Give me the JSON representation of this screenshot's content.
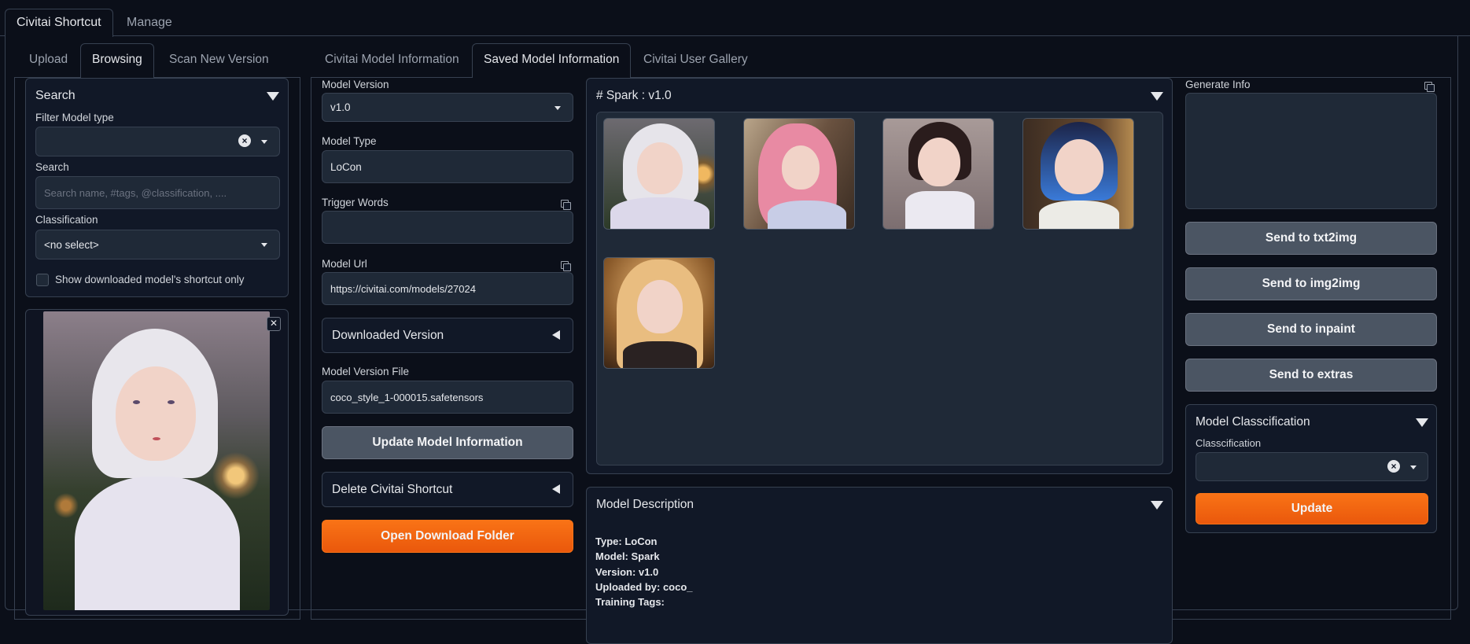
{
  "top_tabs": [
    "Civitai Shortcut",
    "Manage"
  ],
  "left_tabs": [
    "Upload",
    "Browsing",
    "Scan New Version"
  ],
  "info_tabs": [
    "Civitai Model Information",
    "Saved Model Information",
    "Civitai User Gallery"
  ],
  "search_panel": {
    "title": "Search",
    "filter_label": "Filter Model type",
    "filter_value": "",
    "search_label": "Search",
    "search_placeholder": "Search name, #tags, @classification, ....",
    "classification_label": "Classification",
    "classification_value": "<no select>",
    "checkbox_label": "Show downloaded model's shortcut only"
  },
  "model_info": {
    "version_label": "Model Version",
    "version_value": "v1.0",
    "type_label": "Model Type",
    "type_value": "LoCon",
    "trigger_label": "Trigger Words",
    "trigger_value": "",
    "url_label": "Model Url",
    "url_value": "https://civitai.com/models/27024",
    "downloaded_version": "Downloaded Version",
    "file_label": "Model Version File",
    "file_value": "coco_style_1-000015.safetensors",
    "update_button": "Update Model Information",
    "delete_accordion": "Delete Civitai Shortcut",
    "open_folder_button": "Open Download Folder"
  },
  "gallery": {
    "title": "# Spark : v1.0",
    "image_count": 5
  },
  "description": {
    "title": "Model Description",
    "lines": [
      "Type: LoCon",
      "Model: Spark",
      "Version: v1.0",
      "Uploaded by: coco_",
      "Training Tags:"
    ]
  },
  "generate": {
    "label": "Generate Info",
    "value": "",
    "send_txt2img": "Send to txt2img",
    "send_img2img": "Send to img2img",
    "send_inpaint": "Send to inpaint",
    "send_extras": "Send to extras"
  },
  "classification_panel": {
    "title": "Model Classcification",
    "label": "Classcification",
    "value": "",
    "update_button": "Update"
  },
  "colors": {
    "background": "#0b0f19",
    "panel": "#111827",
    "input": "#1f2937",
    "accent": "#f97316",
    "secondary_button": "#4b5563"
  }
}
